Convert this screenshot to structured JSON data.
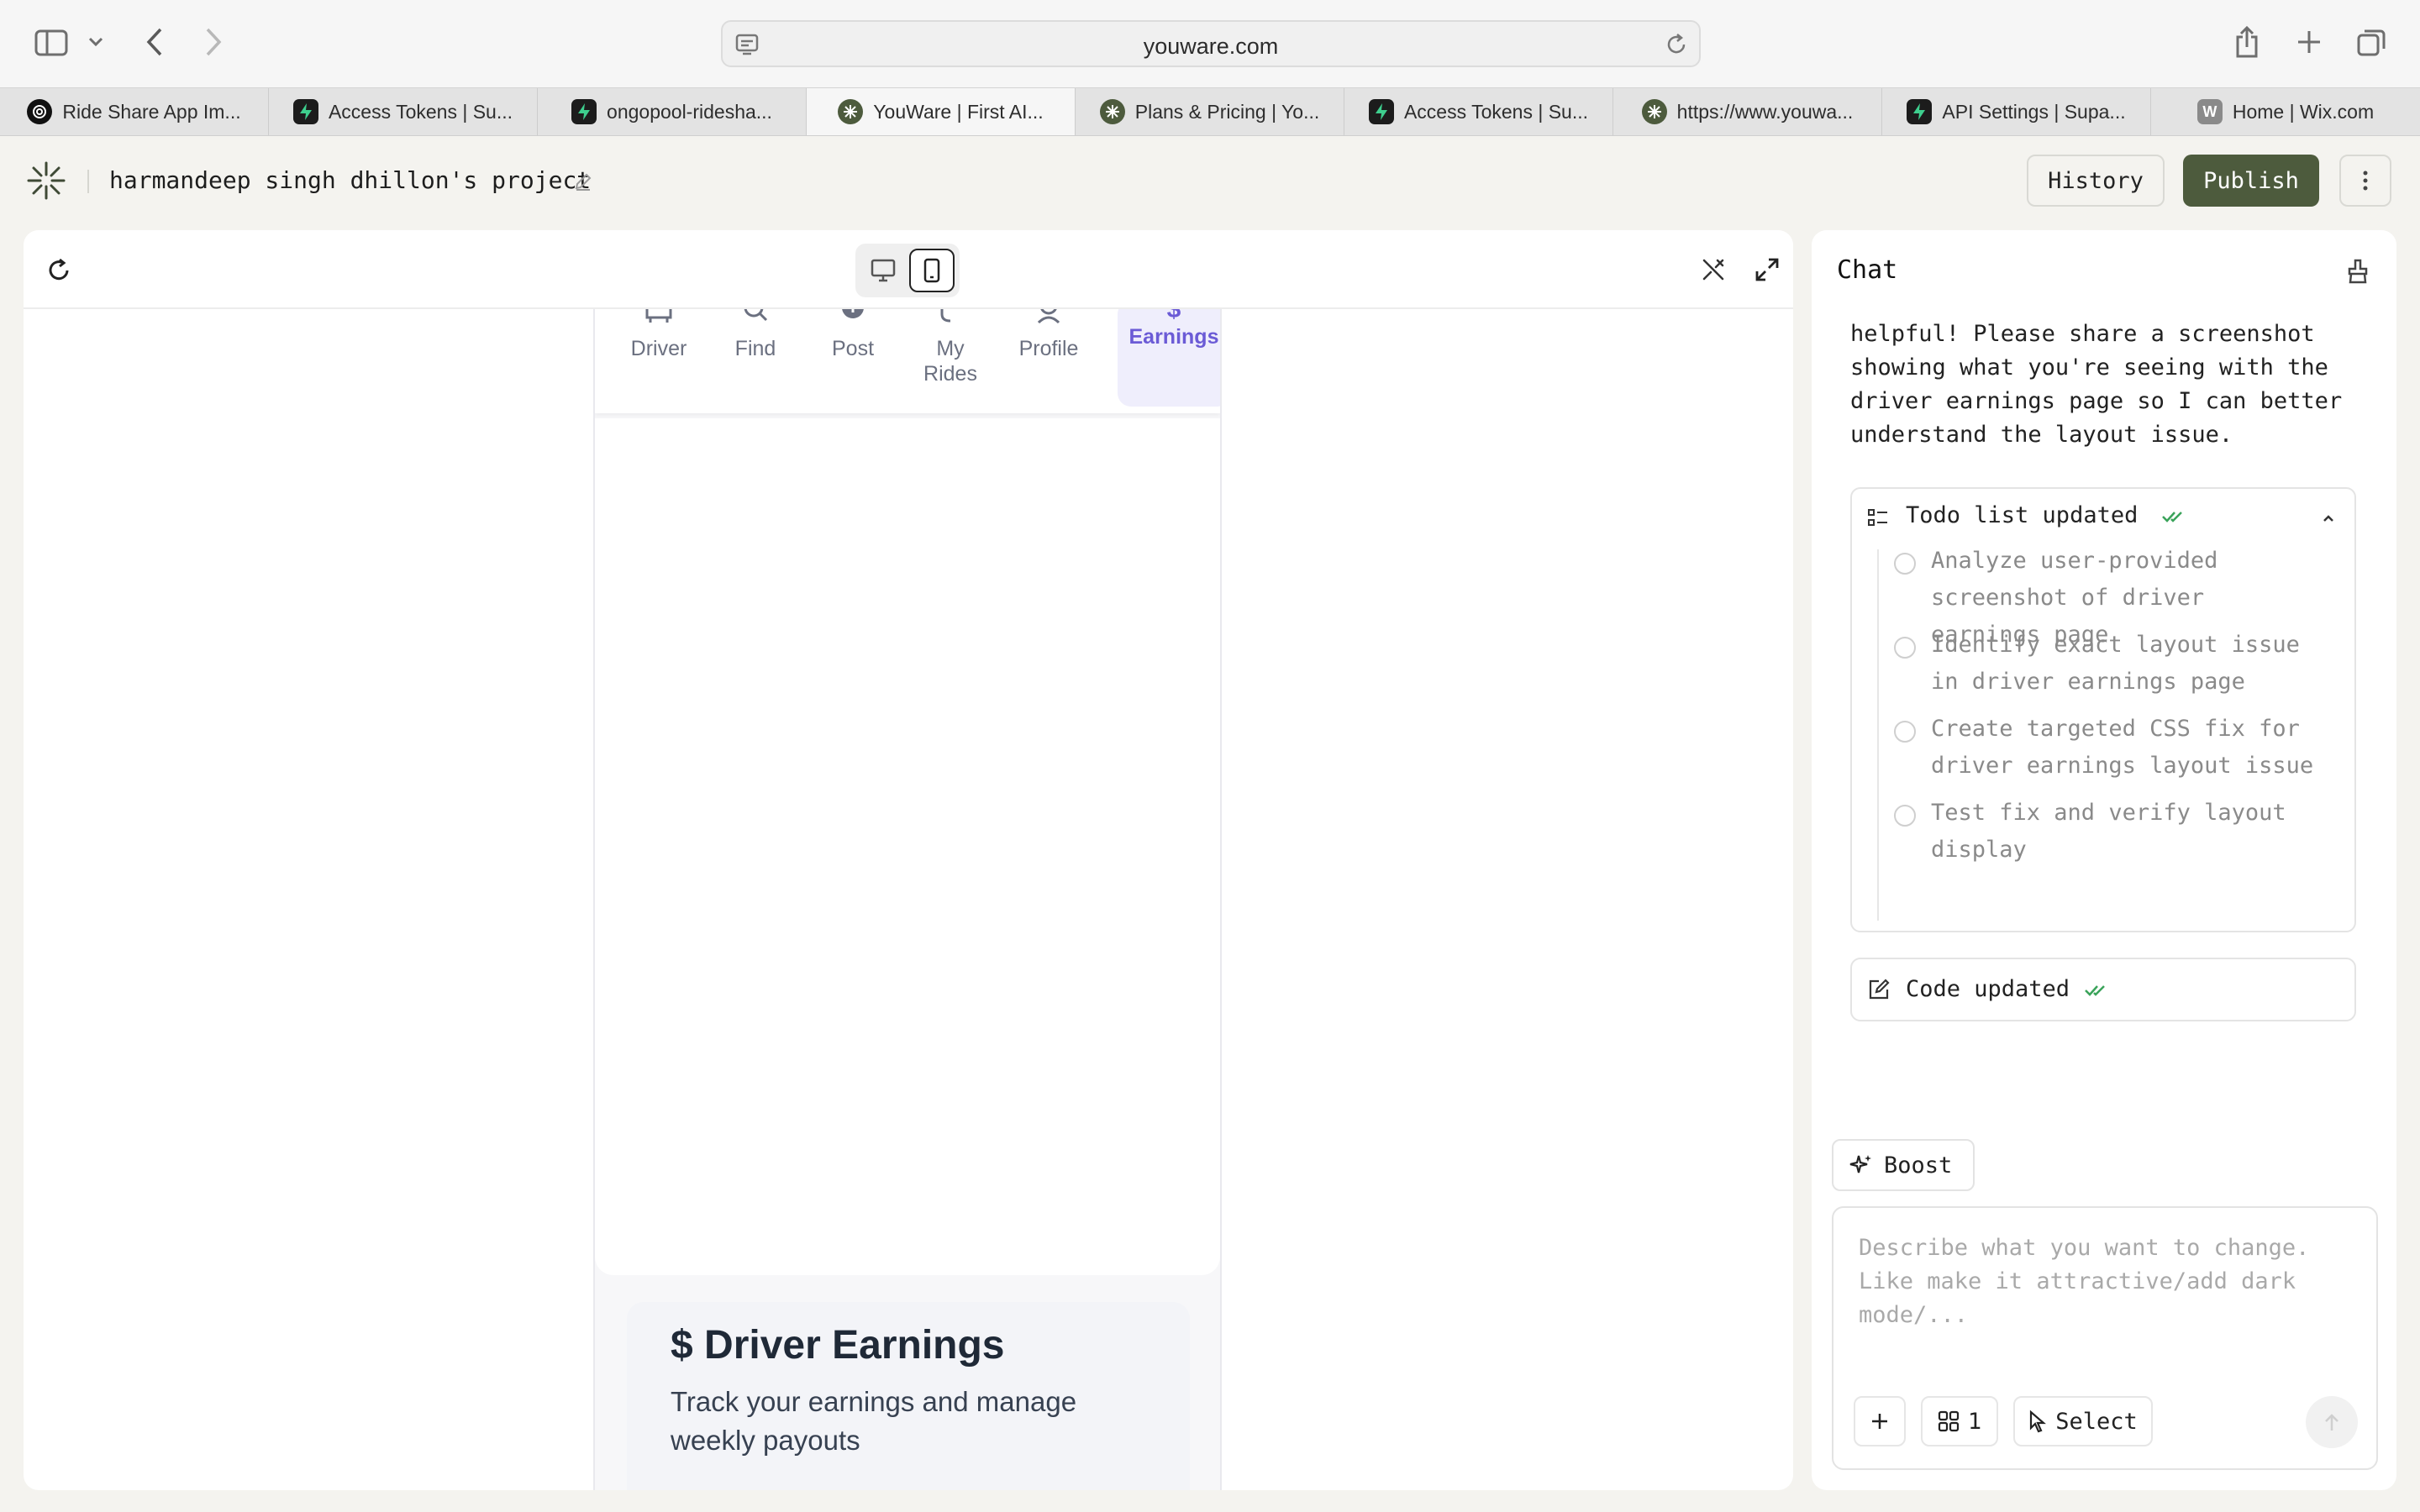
{
  "browser": {
    "url": "youware.com",
    "tabs": [
      {
        "title": "Ride Share App Im...",
        "icon": "openai-icon",
        "active": false
      },
      {
        "title": "Access Tokens | Su...",
        "icon": "supabase-icon",
        "active": false
      },
      {
        "title": "ongopool-ridesha...",
        "icon": "supabase-icon",
        "active": false
      },
      {
        "title": "YouWare | First AI...",
        "icon": "youware-icon",
        "active": true
      },
      {
        "title": "Plans & Pricing | Yo...",
        "icon": "youware-icon",
        "active": false
      },
      {
        "title": "Access Tokens | Su...",
        "icon": "supabase-icon",
        "active": false
      },
      {
        "title": "https://www.youwa...",
        "icon": "youware-icon",
        "active": false
      },
      {
        "title": "API Settings | Supa...",
        "icon": "supabase-icon",
        "active": false
      },
      {
        "title": "Home | Wix.com",
        "icon": "wix-icon",
        "active": false
      }
    ]
  },
  "header": {
    "project_title": "harmandeep singh dhillon's project",
    "history_label": "History",
    "publish_label": "Publish"
  },
  "preview": {
    "nav": [
      {
        "label": "Driver",
        "icon": "car-icon"
      },
      {
        "label": "Find",
        "icon": "search-icon"
      },
      {
        "label": "Post",
        "icon": "plus-circle-icon"
      },
      {
        "label": "My Rides",
        "icon": "route-icon"
      },
      {
        "label": "Profile",
        "icon": "user-icon"
      },
      {
        "label": "Earnings",
        "icon": "dollar-icon",
        "active": true
      }
    ],
    "earnings_title": "$ Driver Earnings",
    "earnings_subtitle": "Track your earnings and manage weekly payouts"
  },
  "chat": {
    "title": "Chat",
    "message": "helpful! Please share a screenshot showing what you're seeing with the driver earnings page so I can better understand the layout issue.",
    "todo_title": "Todo list updated",
    "todos": [
      "Analyze user-provided screenshot of driver earnings page",
      "Identify exact layout issue in driver earnings page",
      "Create targeted CSS fix for driver earnings layout issue",
      "Test fix and verify layout display"
    ],
    "code_updated": "Code updated",
    "boost_label": "Boost",
    "input_placeholder": "Describe what you want to change. Like make it attractive/add dark mode/...",
    "mention_count": "1",
    "select_label": "Select"
  },
  "colors": {
    "publish_bg": "#4d5b3d",
    "active_nav": "#6b5bd6",
    "check_green": "#3aa35a"
  }
}
